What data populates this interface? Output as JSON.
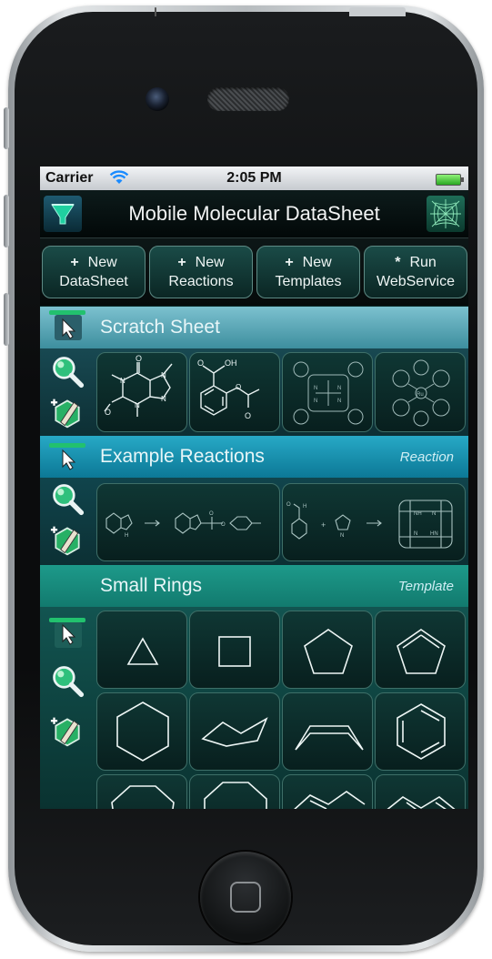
{
  "status_bar": {
    "carrier": "Carrier",
    "time": "2:05 PM"
  },
  "nav": {
    "title": "Mobile Molecular DataSheet"
  },
  "toolbar": {
    "buttons": [
      {
        "symbol": "+",
        "line1": "New",
        "line2": "DataSheet"
      },
      {
        "symbol": "+",
        "line1": "New",
        "line2": "Reactions"
      },
      {
        "symbol": "+",
        "line1": "New",
        "line2": "Templates"
      },
      {
        "symbol": "*",
        "line1": "Run",
        "line2": "WebService"
      }
    ]
  },
  "sections": [
    {
      "title": "Scratch Sheet",
      "tag": ""
    },
    {
      "title": "Example Reactions",
      "tag": "Reaction"
    },
    {
      "title": "Small Rings",
      "tag": "Template"
    }
  ],
  "icons": {
    "app_logo": "funnel-logo-icon",
    "web": "spiderweb-icon",
    "select": "arrow-cursor-icon",
    "search": "magnifier-icon",
    "edit": "pencil-edit-icon"
  },
  "colors": {
    "scratch_header": "#4a99a8",
    "reaction_header": "#0f89a8",
    "rings_header": "#17897e",
    "accent_green": "#22c16e"
  }
}
